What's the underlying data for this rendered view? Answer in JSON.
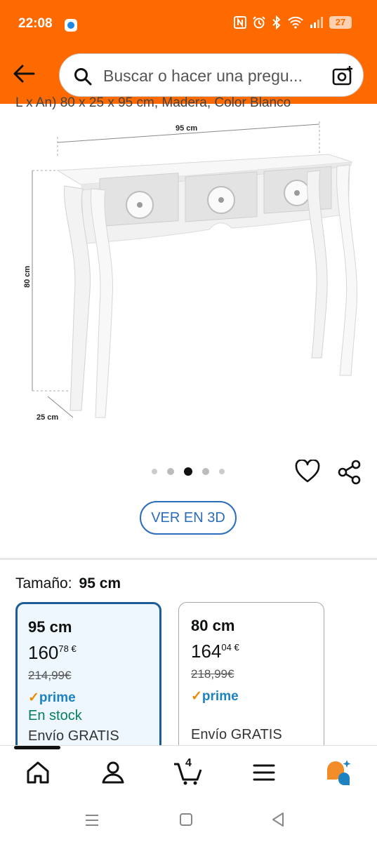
{
  "status_bar": {
    "time": "22:08",
    "battery": "27"
  },
  "search": {
    "placeholder": "Buscar o hacer una pregu..."
  },
  "product": {
    "title_partial": "L x An) 80 x 25 x 95 cm, Madera, Color Blanco"
  },
  "image": {
    "dimensions": {
      "width": "95 cm",
      "height": "80 cm",
      "depth": "25 cm"
    },
    "carousel_count": 5,
    "carousel_active": 2
  },
  "view_3d_label": "VER EN 3D",
  "size": {
    "label": "Tamaño:",
    "selected": "95 cm"
  },
  "options": [
    {
      "name": "95 cm",
      "price_whole": "160",
      "price_fraction": "78",
      "currency": "€",
      "old_price": "214,99€",
      "prime_check": "✓",
      "prime_label": "prime",
      "stock": "En stock",
      "shipping": "Envío GRATIS",
      "selected": true
    },
    {
      "name": "80 cm",
      "price_whole": "164",
      "price_fraction": "04",
      "currency": "€",
      "old_price": "218,99€",
      "prime_check": "✓",
      "prime_label": "prime",
      "stock": "",
      "shipping": "Envío GRATIS",
      "selected": false
    }
  ],
  "bottom_nav": {
    "items": [
      {
        "icon": "home-icon"
      },
      {
        "icon": "account-icon"
      },
      {
        "icon": "cart-icon",
        "count": "4"
      },
      {
        "icon": "menu-icon"
      },
      {
        "icon": "rufus-assistant-icon"
      }
    ]
  },
  "colors": {
    "brand": "#ff6a00",
    "selected_border": "#1c5d99",
    "link": "#2a6dbb",
    "prime": "#1f82c0",
    "stock": "#067d62"
  }
}
